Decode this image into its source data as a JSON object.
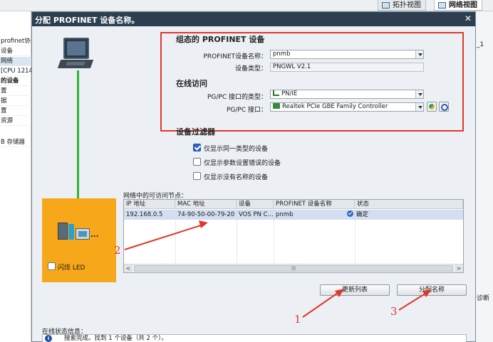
{
  "background": {
    "tabs": [
      {
        "label": "拓扑视图",
        "active": false
      },
      {
        "label": "网络视图",
        "active": true
      }
    ],
    "left_tree": [
      {
        "text": "profinet协",
        "bold": false,
        "selected": false
      },
      {
        "text": "设备",
        "bold": false,
        "selected": false
      },
      {
        "text": "网络",
        "bold": false,
        "selected": true
      },
      {
        "text": "[CPU 1214",
        "bold": false,
        "selected": false
      },
      {
        "text": "的设备",
        "bold": true,
        "selected": false
      },
      {
        "text": "置",
        "bold": false,
        "selected": false
      },
      {
        "text": "据",
        "bold": false,
        "selected": false
      },
      {
        "text": "置",
        "bold": false,
        "selected": false
      },
      {
        "text": "资源",
        "bold": false,
        "selected": false
      },
      {
        "text": "B 存储器",
        "bold": false,
        "selected": false
      }
    ],
    "right_labels": [
      "_1",
      "诊断"
    ]
  },
  "dialog": {
    "title": "分配 PROFINET 设备名称。",
    "close_glyph": "✕",
    "flash_led_label": "闪烁 LED",
    "configured_section": {
      "heading": "组态的 PROFINET 设备",
      "device_name_label": "PROFINET设备名称：",
      "device_name_value": "pnmb",
      "device_type_label": "设备类型：",
      "device_type_value": "PNGWL V2.1"
    },
    "online_section": {
      "heading": "在线访问",
      "pgpc_type_label": "PG/PC 接口的类型：",
      "pgpc_type_value": "PN/IE",
      "pgpc_iface_label": "PG/PC 接口：",
      "pgpc_iface_value": "Realtek PCIe GBE Family Controller"
    },
    "filter_section": {
      "heading": "设备过滤器",
      "options": [
        {
          "label": "仅显示同一类型的设备",
          "checked": true
        },
        {
          "label": "仅显示参数设置错误的设备",
          "checked": false
        },
        {
          "label": "仅显示没有名称的设备",
          "checked": false
        }
      ]
    },
    "table": {
      "title": "网络中的可访问节点：",
      "columns": [
        "IP 地址",
        "MAC 地址",
        "设备",
        "PROFINET 设备名称",
        "状态"
      ],
      "rows": [
        {
          "ip": "192.168.0.5",
          "mac": "74-90-50-00-79-20",
          "device": "VOS PN C...",
          "name": "pnmb",
          "status": "确定"
        }
      ],
      "scroll_glyph_left": "<",
      "scroll_glyph_right": ">",
      "scroll_thumb": "|||"
    },
    "buttons": {
      "update_list": "更新列表",
      "assign_name": "分配名称"
    },
    "status": {
      "title": "在线状态信息：",
      "icon_glyph": "i",
      "message": "搜索完成。找到 1 个设备（共 2 个）。"
    }
  },
  "annotations": {
    "color": "#e0372c",
    "labels": [
      "1",
      "2",
      "3"
    ]
  }
}
